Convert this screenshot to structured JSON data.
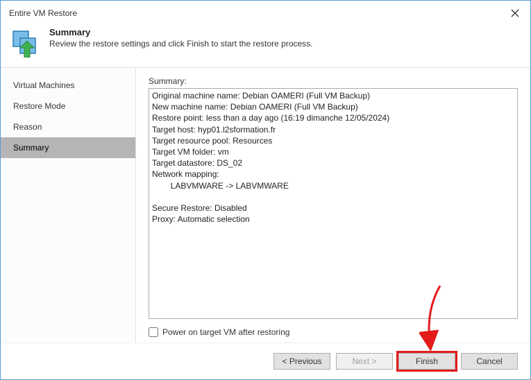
{
  "window": {
    "title": "Entire VM Restore"
  },
  "header": {
    "title": "Summary",
    "subtitle": "Review the restore settings and click Finish to start the restore process."
  },
  "sidebar": {
    "items": [
      {
        "label": "Virtual Machines",
        "active": false
      },
      {
        "label": "Restore Mode",
        "active": false
      },
      {
        "label": "Reason",
        "active": false
      },
      {
        "label": "Summary",
        "active": true
      }
    ]
  },
  "content": {
    "summary_label": "Summary:",
    "summary_text": "Original machine name: Debian OAMERI (Full VM Backup)\nNew machine name: Debian OAMERI (Full VM Backup)\nRestore point: less than a day ago (16:19 dimanche 12/05/2024)\nTarget host: hyp01.l2sformation.fr\nTarget resource pool: Resources\nTarget VM folder: vm\nTarget datastore: DS_02\nNetwork mapping:\n        LABVMWARE -> LABVMWARE\n\nSecure Restore: Disabled\nProxy: Automatic selection",
    "checkbox_label": "Power on target VM after restoring",
    "checkbox_checked": false
  },
  "footer": {
    "previous": "< Previous",
    "next": "Next >",
    "finish": "Finish",
    "cancel": "Cancel"
  }
}
